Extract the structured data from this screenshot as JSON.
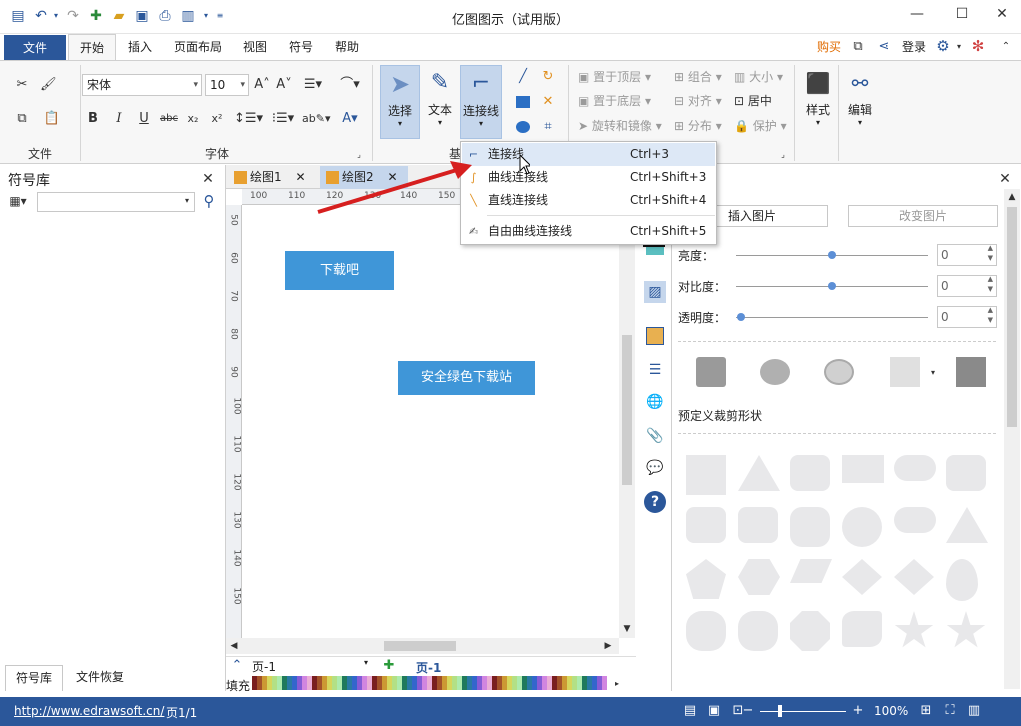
{
  "app": {
    "title": "亿图图示（试用版）"
  },
  "quick_access": [
    "app-icon",
    "undo-icon",
    "redo-icon",
    "new-icon",
    "open-icon",
    "save-icon",
    "print-icon",
    "customize-icon"
  ],
  "menu": {
    "file": "文件",
    "tabs": [
      "开始",
      "插入",
      "页面布局",
      "视图",
      "符号",
      "帮助"
    ],
    "buy": "购买",
    "login": "登录"
  },
  "ribbon": {
    "groups": {
      "file": "文件",
      "font": "字体",
      "basic": "基"
    },
    "font_name": "宋体",
    "font_size": "10",
    "big_buttons": {
      "select": "选择",
      "text": "文本",
      "connector": "连接线",
      "style": "样式",
      "edit": "编辑"
    },
    "arrange": {
      "bring_front": "置于顶层",
      "send_back": "置于底层",
      "rotate": "旋转和镜像",
      "group": "组合",
      "align": "对齐",
      "distribute": "分布",
      "size": "大小",
      "center": "居中",
      "protect": "保护"
    }
  },
  "dropdown": {
    "items": [
      {
        "label": "连接线",
        "shortcut": "Ctrl+3",
        "icon": "connector-icon"
      },
      {
        "label": "曲线连接线",
        "shortcut": "Ctrl+Shift+3",
        "icon": "curve-connector-icon"
      },
      {
        "label": "直线连接线",
        "shortcut": "Ctrl+Shift+4",
        "icon": "straight-connector-icon"
      },
      {
        "label": "自由曲线连接线",
        "shortcut": "Ctrl+Shift+5",
        "icon": "freeform-connector-icon"
      }
    ]
  },
  "left_panel": {
    "title": "符号库",
    "search_placeholder": "",
    "bottom_tabs": [
      "符号库",
      "文件恢复"
    ]
  },
  "doc_tabs": [
    "绘图1",
    "绘图2"
  ],
  "ruler": {
    "h": [
      "100",
      "110",
      "120",
      "130",
      "140",
      "150"
    ],
    "v": [
      "50",
      "60",
      "70",
      "80",
      "90",
      "100",
      "110",
      "120",
      "130",
      "140",
      "150"
    ]
  },
  "canvas": {
    "shape1": "下载吧",
    "shape2": "安全绿色下载站"
  },
  "pagebar": {
    "page_select": "页-1",
    "page_tab": "页-1",
    "fill_label": "填充"
  },
  "right_panel": {
    "insert_image": "插入图片",
    "change_image": "改变图片",
    "brightness": "亮度：",
    "contrast": "对比度：",
    "transparency": "透明度：",
    "brightness_val": "0",
    "contrast_val": "0",
    "transparency_val": "0",
    "crop_label": "预定义裁剪形状"
  },
  "status": {
    "url": "http://www.edrawsoft.cn/",
    "page": "页1/1",
    "zoom": "100%"
  },
  "colors": {
    "accent": "#2b579a",
    "shape": "#3f96d8",
    "buy": "#e06b00"
  }
}
